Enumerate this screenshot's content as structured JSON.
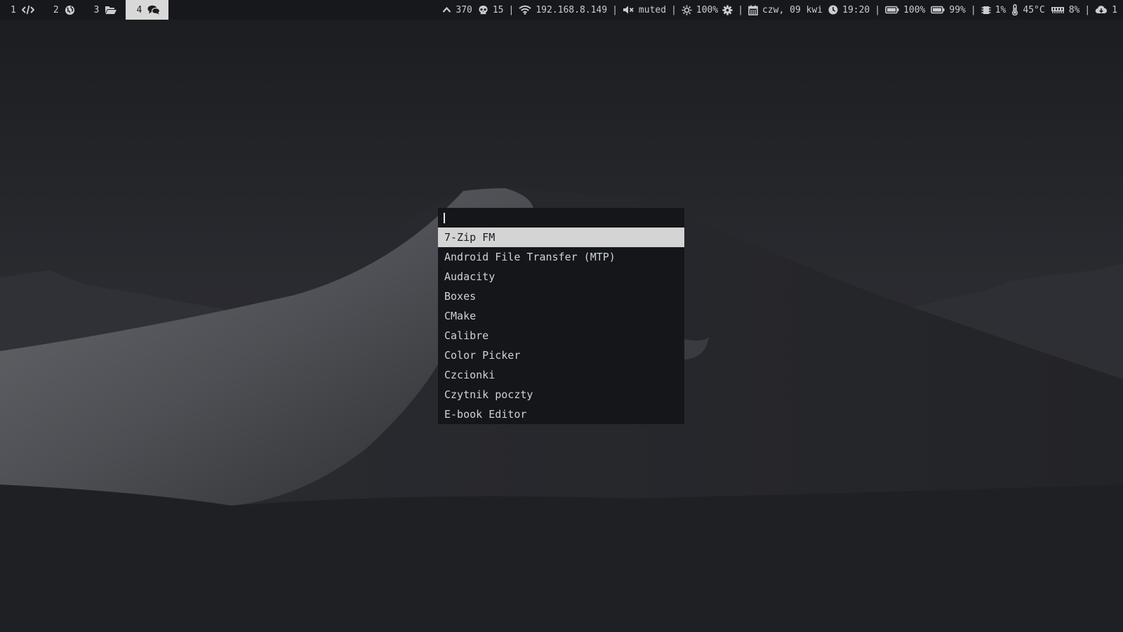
{
  "workspaces": [
    {
      "number": "1",
      "icon": "code-icon",
      "active": false
    },
    {
      "number": "2",
      "icon": "globe-icon",
      "active": false
    },
    {
      "number": "3",
      "icon": "folder-open-icon",
      "active": false
    },
    {
      "number": "4",
      "icon": "chat-bubbles-icon",
      "active": true
    }
  ],
  "status_bar": {
    "updates": "370",
    "skull_count": "15",
    "ip_address": "192.168.8.149",
    "volume": "muted",
    "brightness": "100%",
    "date": "czw, 09 kwi",
    "time": "19:20",
    "battery_1": "100%",
    "battery_2": "99%",
    "cpu": "1%",
    "temperature": "45°C",
    "memory": "8%",
    "cloud": "1",
    "separator": "|"
  },
  "launcher": {
    "query": "",
    "results": [
      "7-Zip FM",
      "Android File Transfer (MTP)",
      "Audacity",
      "Boxes",
      "CMake",
      "Calibre",
      "Color Picker",
      "Czcionki",
      "Czytnik poczty",
      "E-book Editor"
    ],
    "selected_index": 0
  },
  "colors": {
    "bar_background": "#17181c",
    "active_workspace": "#d8d8d8",
    "launcher_background": "#141619",
    "selected_item": "#d4d4d4",
    "desktop_background": "#1f2024"
  }
}
